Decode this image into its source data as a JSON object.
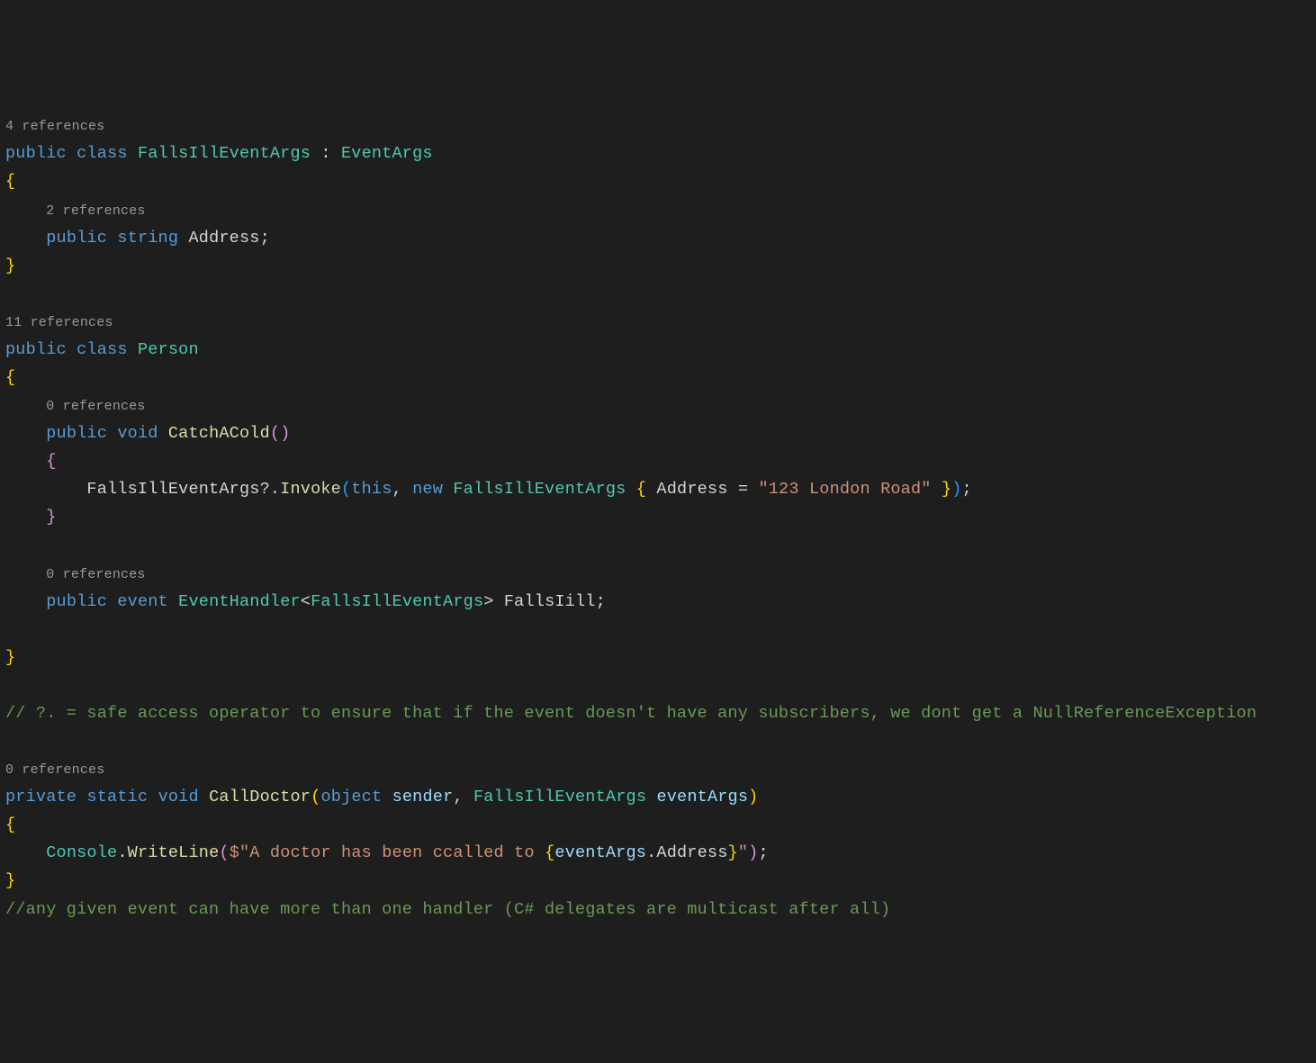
{
  "codelens": {
    "refs4": "4 references",
    "refs2": "2 references",
    "refs11": "11 references",
    "refs0a": "0 references",
    "refs0b": "0 references",
    "refs0c": "0 references"
  },
  "tok": {
    "public": "public",
    "class": "class",
    "FallsIllEventArgs": "FallsIllEventArgs",
    "colon": " : ",
    "EventArgs": "EventArgs",
    "lbrace": "{",
    "rbrace": "}",
    "string": "string",
    "Address": "Address",
    "semi": ";",
    "Person": "Person",
    "void": "void",
    "CatchACold": "CatchACold",
    "lparen": "(",
    "rparen": ")",
    "qDot": "?.",
    "Invoke": "Invoke",
    "this": "this",
    "comma": ", ",
    "new": "new",
    "sp": " ",
    "Address2": "Address",
    "eq": " = ",
    "strLondon": "\"123 London Road\"",
    "event": "event",
    "EventHandler": "EventHandler",
    "lt": "<",
    "gt": ">",
    "FallsIill": "FallsIill",
    "comment1": "// ?. = safe access operator to ensure that if the event doesn't have any subscribers, we dont get a NullReferenceException",
    "private": "private",
    "static": "static",
    "CallDoctor": "CallDoctor",
    "object": "object",
    "sender": "sender",
    "eventArgs": "eventArgs",
    "Console": "Console",
    "dot": ".",
    "WriteLine": "WriteLine",
    "dollar": "$",
    "strA": "\"A doctor has been ccalled to ",
    "interpOpen": "{",
    "interpEA": "eventArgs",
    "interpDot": ".",
    "interpAddr": "Address",
    "interpClose": "}",
    "strB": "\"",
    "comment2": "//any given event can have more than one handler (C# delegates are multicast after all)"
  }
}
